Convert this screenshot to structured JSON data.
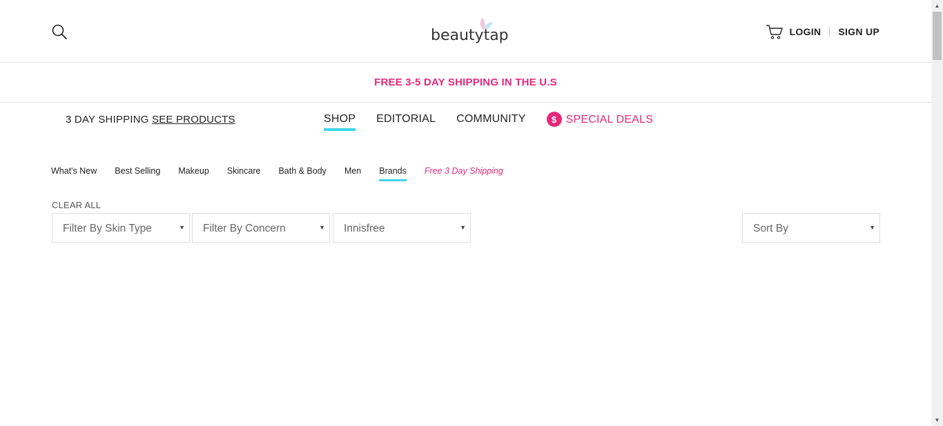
{
  "header": {
    "logo_text": "beautytap",
    "search_icon": "search-icon",
    "cart_icon": "cart-icon",
    "login_label": "LOGIN",
    "signup_label": "SIGN UP"
  },
  "promo": {
    "text": "FREE 3-5 DAY SHIPPING IN THE U.S"
  },
  "ship_note": {
    "label": "3 DAY SHIPPING",
    "link": "SEE PRODUCTS"
  },
  "main_nav": {
    "items": [
      {
        "label": "SHOP",
        "active": true
      },
      {
        "label": "EDITORIAL"
      },
      {
        "label": "COMMUNITY"
      }
    ],
    "deals_badge": "$",
    "deals_label": "SPECIAL DEALS"
  },
  "sub_nav": {
    "items": [
      {
        "label": "What's New"
      },
      {
        "label": "Best Selling"
      },
      {
        "label": "Makeup"
      },
      {
        "label": "Skincare"
      },
      {
        "label": "Bath & Body"
      },
      {
        "label": "Men"
      },
      {
        "label": "Brands",
        "active": true
      },
      {
        "label": "Free 3 Day Shipping"
      }
    ]
  },
  "filters": {
    "clear_all": "CLEAR ALL",
    "skin_type": "Filter By Skin Type",
    "concern": "Filter By Concern",
    "brand": "Innisfree",
    "sort": "Sort By"
  },
  "colors": {
    "accent_pink": "#e6287a",
    "accent_cyan": "#3ed4e8"
  }
}
